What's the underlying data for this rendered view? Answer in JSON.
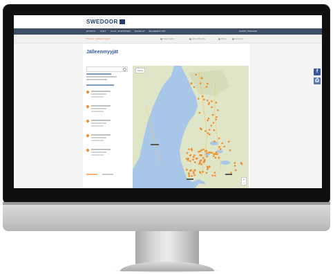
{
  "brand": {
    "name": "SWEDOOR"
  },
  "nav": {
    "items": [
      "ETUSIVU",
      "OVET",
      "ULKO- JA SISÄOVET",
      "PALVELUT",
      "JÄLLEENMYYJÄT"
    ],
    "right": "SUOMI / FINLAND"
  },
  "subbar": {
    "breadcrumb": "Etusivu / Jälleenmyyjät",
    "links": [
      "Tilaa esite",
      "Ota yhteyttä",
      "Haku",
      "Kirjaudu"
    ]
  },
  "page": {
    "title": "Jälleenmyyjät"
  },
  "search": {
    "placeholder": ""
  },
  "map": {
    "toggle": "Kartta",
    "zoom_in": "+",
    "zoom_out": "−",
    "marker_color": "#f28b2c",
    "land_color": "#dfe6c8",
    "water_color": "#a8c6e8"
  },
  "social": {
    "facebook": "f",
    "print": "⎙"
  },
  "colors": {
    "brand": "#1f3e6e",
    "nav": "#3f4f66",
    "title": "#2d5a9a",
    "accent": "#f28b2c"
  }
}
